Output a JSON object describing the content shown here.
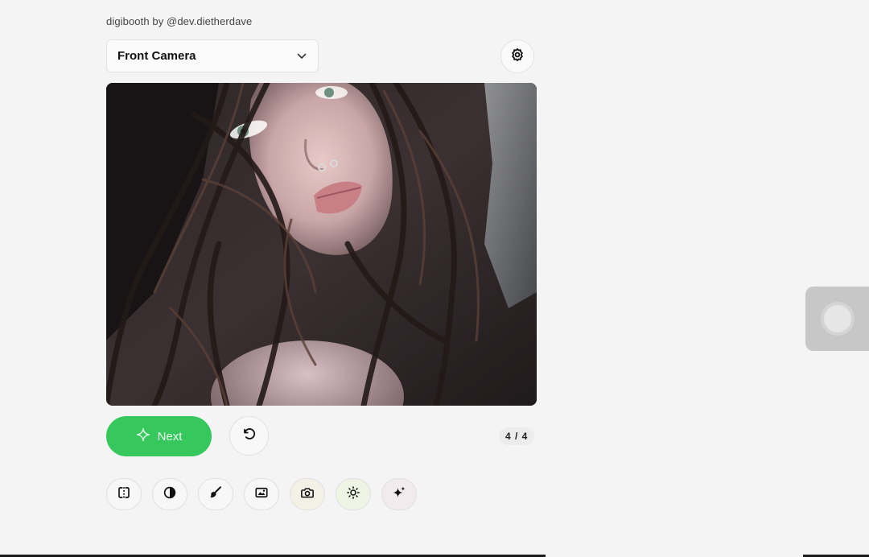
{
  "header": {
    "credit": "digibooth by @dev.dietherdave"
  },
  "camera_select": {
    "value": "Front Camera",
    "icon": "chevron-down-icon"
  },
  "settings": {
    "icon": "gear-icon"
  },
  "preview": {
    "description_icon": "camera-preview"
  },
  "actions": {
    "next_label": "Next",
    "next_icon": "sparkle-icon",
    "reset_icon": "rotate-ccw-icon",
    "counter": "4 / 4"
  },
  "tools": [
    {
      "icon": "flip-mirror-icon"
    },
    {
      "icon": "contrast-icon"
    },
    {
      "icon": "brush-icon"
    },
    {
      "icon": "image-frame-icon"
    },
    {
      "icon": "camera-icon"
    },
    {
      "icon": "brightness-icon"
    },
    {
      "icon": "sparkles-icon"
    }
  ],
  "colors": {
    "accent": "#37c85d",
    "background": "#f4f4f4"
  }
}
